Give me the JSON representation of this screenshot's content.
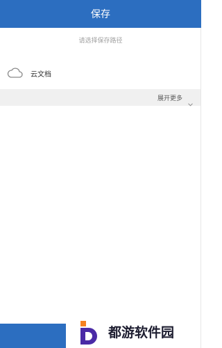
{
  "header": {
    "title": "保存"
  },
  "subtitle": "请选择保存路径",
  "locations": [
    {
      "label": "云文档",
      "icon": "cloud-icon"
    }
  ],
  "expand": {
    "label": "展开更多",
    "icon": "chevron-down-icon"
  },
  "watermark": {
    "text": "都游软件园",
    "logo_letter": "D"
  },
  "colors": {
    "primary": "#2c6ec0",
    "expand_bg": "#f0f0f0",
    "logo_orange": "#f58220",
    "logo_purple": "#4a2aa6"
  }
}
